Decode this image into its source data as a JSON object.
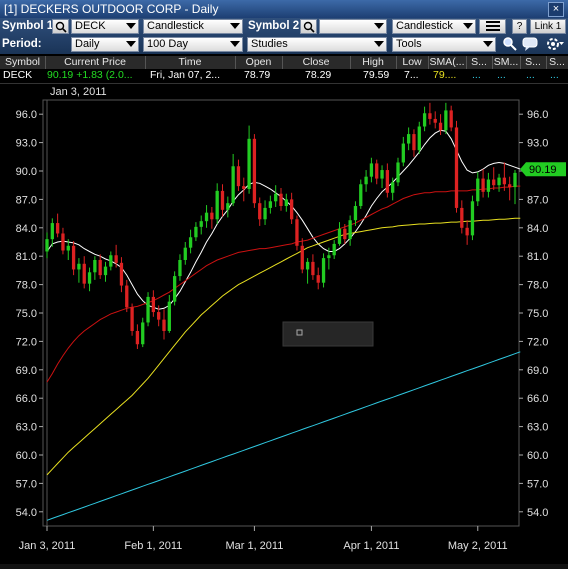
{
  "window": {
    "title": "[1] DECKERS OUTDOOR CORP - Daily",
    "close_label": "×"
  },
  "toolbar": {
    "symbol1_label": "Symbol 1:",
    "symbol1_value": "DECK",
    "chart_type_1": "Candlestick",
    "symbol2_label": "Symbol 2:",
    "symbol2_value": "",
    "chart_type_2": "Candlestick",
    "help_label": "?",
    "link_label": "Link 1",
    "period_label": "Period:",
    "period_value": "Daily",
    "range_value": "100 Day",
    "studies_value": "Studies",
    "tools_value": "Tools"
  },
  "quote": {
    "headers": [
      "Symbol",
      "Current Price",
      "Time",
      "Open",
      "Close",
      "High",
      "Low",
      "SMA(...",
      "S...",
      "SM...",
      "S...",
      "S..."
    ],
    "row": {
      "symbol": "DECK",
      "price": "90.19",
      "change": "+1.83 (2.0...",
      "time": "Fri, Jan 07, 2...",
      "open": "78.79",
      "close": "78.29",
      "high": "79.59",
      "low": "7...",
      "sma": "79....",
      "extra": [
        "...",
        "...",
        "...",
        "..."
      ]
    }
  },
  "colors": {
    "up_candle": "#22cc22",
    "down_candle": "#dd2222",
    "sma_white": "#ffffff",
    "sma_red": "#cc1111",
    "sma_yellow": "#e8e020",
    "sma_cyan": "#30c8e0",
    "price_tag": "#22cc22",
    "sma_value_text": "#e8e020",
    "change_text": "#22dd22"
  },
  "chart_data": {
    "type": "candlestick",
    "ylim": [
      52.5,
      97.5
    ],
    "y_ticks": [
      "96.0",
      "93.0",
      "90.0",
      "87.0",
      "84.0",
      "81.0",
      "78.0",
      "75.0",
      "72.0",
      "69.0",
      "66.0",
      "63.0",
      "60.0",
      "57.0",
      "54.0"
    ],
    "x_tick_labels": [
      {
        "label": "Jan 3, 2011",
        "index": 0
      },
      {
        "label": "Feb 1, 2011",
        "index": 20
      },
      {
        "label": "Mar 1, 2011",
        "index": 39
      },
      {
        "label": "Apr 1, 2011",
        "index": 61
      },
      {
        "label": "May 2, 2011",
        "index": 81
      }
    ],
    "crosshair_label": "Jan 3, 2011",
    "last_price_tag": "90.19",
    "ohlc": [
      [
        81.5,
        83.5,
        80.8,
        82.8
      ],
      [
        82.8,
        85.0,
        82.0,
        84.5
      ],
      [
        84.5,
        85.5,
        83.0,
        83.4
      ],
      [
        83.4,
        84.0,
        81.2,
        81.6
      ],
      [
        81.6,
        82.8,
        80.6,
        82.1
      ],
      [
        82.1,
        82.6,
        79.0,
        79.6
      ],
      [
        79.6,
        80.8,
        78.2,
        80.2
      ],
      [
        80.2,
        81.0,
        77.6,
        78.1
      ],
      [
        78.1,
        79.8,
        77.3,
        79.3
      ],
      [
        79.3,
        81.0,
        78.5,
        80.6
      ],
      [
        80.6,
        81.2,
        78.6,
        79.0
      ],
      [
        79.0,
        80.4,
        78.3,
        79.9
      ],
      [
        79.9,
        81.5,
        79.5,
        81.1
      ],
      [
        81.1,
        82.2,
        79.8,
        80.3
      ],
      [
        80.3,
        80.9,
        77.2,
        77.9
      ],
      [
        77.9,
        78.5,
        75.1,
        75.6
      ],
      [
        75.6,
        76.0,
        72.6,
        73.1
      ],
      [
        73.1,
        73.8,
        71.2,
        71.7
      ],
      [
        71.7,
        74.5,
        71.4,
        74.0
      ],
      [
        74.0,
        77.2,
        73.6,
        76.7
      ],
      [
        76.7,
        77.4,
        74.6,
        75.1
      ],
      [
        75.1,
        75.8,
        73.6,
        74.3
      ],
      [
        74.3,
        75.4,
        72.2,
        73.1
      ],
      [
        73.1,
        76.9,
        72.9,
        76.2
      ],
      [
        76.2,
        79.4,
        75.8,
        78.9
      ],
      [
        78.9,
        81.2,
        78.4,
        80.6
      ],
      [
        80.6,
        82.5,
        80.1,
        81.9
      ],
      [
        81.9,
        83.8,
        81.3,
        83.0
      ],
      [
        83.0,
        84.6,
        82.6,
        84.1
      ],
      [
        84.1,
        85.3,
        83.3,
        84.7
      ],
      [
        84.7,
        86.4,
        84.0,
        85.6
      ],
      [
        85.6,
        86.2,
        83.9,
        84.9
      ],
      [
        84.9,
        88.7,
        84.4,
        87.9
      ],
      [
        87.9,
        88.6,
        85.2,
        85.9
      ],
      [
        85.9,
        87.3,
        85.1,
        86.6
      ],
      [
        86.6,
        91.8,
        86.3,
        90.5
      ],
      [
        90.5,
        91.2,
        87.9,
        88.4
      ],
      [
        88.4,
        89.3,
        86.8,
        88.1
      ],
      [
        88.1,
        94.8,
        87.6,
        93.4
      ],
      [
        93.4,
        93.9,
        86.1,
        86.6
      ],
      [
        86.6,
        87.2,
        84.2,
        84.9
      ],
      [
        84.9,
        86.9,
        84.3,
        86.1
      ],
      [
        86.1,
        87.4,
        85.5,
        86.8
      ],
      [
        86.8,
        88.5,
        86.2,
        87.6
      ],
      [
        87.6,
        88.2,
        85.8,
        86.3
      ],
      [
        86.3,
        87.6,
        85.7,
        87.0
      ],
      [
        87.0,
        87.7,
        84.4,
        84.9
      ],
      [
        84.9,
        85.3,
        81.6,
        82.1
      ],
      [
        82.1,
        82.9,
        79.2,
        79.6
      ],
      [
        79.6,
        80.8,
        78.1,
        80.4
      ],
      [
        80.4,
        81.2,
        78.5,
        79.0
      ],
      [
        79.0,
        79.8,
        77.5,
        78.2
      ],
      [
        78.2,
        81.3,
        77.7,
        80.8
      ],
      [
        80.8,
        81.9,
        79.6,
        81.1
      ],
      [
        81.1,
        82.7,
        80.7,
        82.3
      ],
      [
        82.3,
        84.6,
        82.1,
        83.9
      ],
      [
        83.9,
        84.4,
        82.3,
        82.8
      ],
      [
        82.8,
        85.3,
        82.1,
        84.8
      ],
      [
        84.8,
        86.8,
        84.2,
        86.3
      ],
      [
        86.3,
        89.1,
        86.0,
        88.6
      ],
      [
        88.6,
        90.1,
        87.8,
        89.4
      ],
      [
        89.4,
        91.4,
        88.8,
        90.8
      ],
      [
        90.8,
        91.2,
        88.6,
        89.2
      ],
      [
        89.2,
        90.6,
        88.2,
        90.1
      ],
      [
        90.1,
        90.8,
        87.2,
        87.7
      ],
      [
        87.7,
        89.3,
        86.9,
        88.8
      ],
      [
        88.8,
        91.4,
        88.4,
        90.9
      ],
      [
        90.9,
        93.6,
        90.5,
        92.9
      ],
      [
        92.9,
        94.6,
        92.2,
        93.9
      ],
      [
        93.9,
        94.4,
        91.5,
        92.2
      ],
      [
        92.2,
        95.2,
        91.8,
        94.7
      ],
      [
        94.7,
        96.8,
        94.2,
        96.1
      ],
      [
        96.1,
        97.2,
        94.9,
        95.5
      ],
      [
        95.5,
        96.3,
        94.5,
        95.1
      ],
      [
        95.1,
        96.0,
        93.8,
        94.3
      ],
      [
        94.3,
        97.2,
        93.9,
        96.4
      ],
      [
        96.4,
        96.9,
        94.2,
        94.6
      ],
      [
        94.6,
        95.3,
        85.6,
        86.1
      ],
      [
        86.1,
        86.9,
        83.4,
        84.0
      ],
      [
        84.0,
        84.8,
        82.2,
        83.2
      ],
      [
        83.2,
        87.4,
        82.7,
        86.8
      ],
      [
        86.8,
        89.9,
        86.3,
        89.2
      ],
      [
        89.2,
        90.2,
        87.2,
        87.8
      ],
      [
        87.8,
        89.8,
        87.2,
        89.1
      ],
      [
        89.1,
        90.4,
        88.0,
        88.5
      ],
      [
        88.5,
        89.7,
        87.8,
        89.3
      ],
      [
        89.3,
        90.9,
        87.9,
        88.6
      ],
      [
        88.6,
        89.4,
        86.9,
        88.3
      ],
      [
        88.3,
        90.1,
        86.5,
        89.8
      ]
    ],
    "series": [
      {
        "color": "#ffffff",
        "values": [
          81.5,
          82.3,
          82.5,
          82.6,
          82.5,
          82.4,
          82.2,
          81.8,
          81.5,
          81.2,
          81.0,
          80.7,
          80.5,
          80.2,
          79.8,
          79.0,
          78.0,
          77.0,
          76.3,
          75.8,
          75.6,
          75.4,
          75.5,
          75.8,
          76.5,
          77.3,
          78.3,
          79.3,
          80.4,
          81.4,
          82.5,
          83.4,
          84.4,
          85.2,
          85.9,
          86.8,
          87.5,
          88.0,
          88.6,
          88.8,
          88.7,
          88.4,
          88.1,
          87.7,
          87.3,
          86.8,
          86.3,
          85.6,
          84.8,
          83.9,
          83.0,
          82.3,
          81.8,
          81.5,
          81.5,
          81.8,
          82.3,
          82.9,
          83.6,
          84.4,
          85.3,
          86.3,
          87.1,
          87.8,
          88.3,
          88.8,
          89.4,
          90.0,
          90.6,
          91.3,
          92.0,
          92.8,
          93.5,
          94.0,
          94.3,
          94.2,
          93.4,
          92.2,
          91.0,
          90.1,
          89.8,
          89.9,
          90.2,
          90.6,
          90.8,
          90.9,
          90.8,
          90.6,
          90.4,
          90.2
        ]
      },
      {
        "color": "#cc1111",
        "values": [
          67.7,
          68.6,
          69.6,
          70.5,
          71.3,
          72.0,
          72.6,
          73.1,
          73.5,
          73.9,
          74.3,
          74.6,
          74.9,
          75.1,
          75.3,
          75.5,
          75.6,
          75.7,
          75.9,
          76.1,
          76.3,
          76.6,
          76.9,
          77.2,
          77.6,
          78.0,
          78.4,
          78.8,
          79.2,
          79.6,
          80.0,
          80.3,
          80.6,
          80.8,
          81.0,
          81.2,
          81.4,
          81.5,
          81.6,
          81.7,
          81.8,
          81.8,
          81.9,
          82.0,
          82.1,
          82.2,
          82.3,
          82.5,
          82.6,
          82.7,
          82.9,
          83.1,
          83.3,
          83.5,
          83.7,
          83.9,
          84.1,
          84.3,
          84.5,
          84.8,
          85.1,
          85.4,
          85.7,
          86.0,
          86.2,
          86.5,
          86.8,
          87.1,
          87.3,
          87.5,
          87.6,
          87.7,
          87.7,
          87.8,
          87.8,
          87.8,
          87.9,
          87.9,
          87.9,
          87.9,
          88.0,
          88.0,
          88.1,
          88.1,
          88.2,
          88.2,
          88.3,
          88.3,
          88.4,
          88.4
        ]
      },
      {
        "color": "#e8e020",
        "values": [
          57.9,
          58.5,
          59.1,
          59.7,
          60.3,
          60.8,
          61.3,
          61.8,
          62.3,
          62.8,
          63.3,
          63.8,
          64.3,
          64.8,
          65.3,
          65.8,
          66.3,
          66.9,
          67.5,
          68.1,
          68.8,
          69.5,
          70.2,
          70.9,
          71.6,
          72.3,
          73.0,
          73.6,
          74.2,
          74.8,
          75.3,
          75.8,
          76.3,
          76.8,
          77.2,
          77.6,
          78.0,
          78.3,
          78.6,
          78.9,
          79.2,
          79.5,
          79.8,
          80.1,
          80.4,
          80.7,
          81.0,
          81.3,
          81.6,
          81.9,
          82.1,
          82.3,
          82.5,
          82.7,
          82.9,
          83.1,
          83.3,
          83.4,
          83.5,
          83.6,
          83.7,
          83.8,
          83.9,
          84.0,
          84.05,
          84.1,
          84.2,
          84.25,
          84.3,
          84.35,
          84.4,
          84.4,
          84.45,
          84.5,
          84.5,
          84.55,
          84.6,
          84.6,
          84.65,
          84.7,
          84.7,
          84.75,
          84.8,
          84.8,
          84.85,
          84.9,
          84.9,
          84.95,
          85.0,
          85.0
        ]
      },
      {
        "color": "#30c8e0",
        "values": [
          53.1,
          53.3,
          53.5,
          53.7,
          53.9,
          54.1,
          54.3,
          54.5,
          54.7,
          54.9,
          55.1,
          55.3,
          55.5,
          55.7,
          55.9,
          56.1,
          56.3,
          56.5,
          56.7,
          56.9,
          57.1,
          57.3,
          57.5,
          57.7,
          57.9,
          58.1,
          58.3,
          58.5,
          58.7,
          58.9,
          59.1,
          59.3,
          59.5,
          59.7,
          59.9,
          60.1,
          60.3,
          60.5,
          60.7,
          60.9,
          61.1,
          61.3,
          61.5,
          61.7,
          61.9,
          62.1,
          62.3,
          62.5,
          62.7,
          62.9,
          63.1,
          63.3,
          63.5,
          63.7,
          63.9,
          64.1,
          64.3,
          64.5,
          64.7,
          64.9,
          65.1,
          65.3,
          65.5,
          65.7,
          65.9,
          66.1,
          66.3,
          66.5,
          66.7,
          66.9,
          67.1,
          67.3,
          67.5,
          67.7,
          67.9,
          68.1,
          68.3,
          68.5,
          68.7,
          68.9,
          69.1,
          69.3,
          69.5,
          69.7,
          69.9,
          70.1,
          70.3,
          70.5,
          70.7,
          70.9
        ]
      }
    ]
  }
}
